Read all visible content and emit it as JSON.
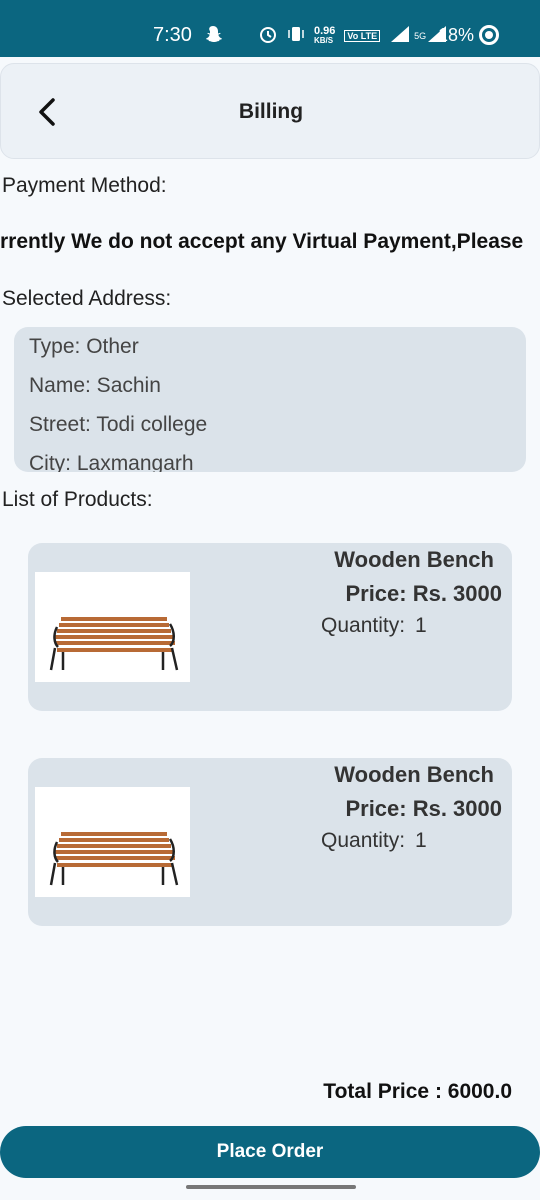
{
  "status_bar": {
    "time": "7:30",
    "speed_value": "0.96",
    "speed_unit": "KB/S",
    "network_volte": "Vo LTE",
    "network_5g": "5G",
    "battery_percent": "18%"
  },
  "header": {
    "title": "Billing"
  },
  "payment": {
    "label": "Payment Method:",
    "notice": "Currently We do not accept any Virtual Payment,Please"
  },
  "address": {
    "label": "Selected Address:",
    "type": "Type: Other",
    "name": "Name: Sachin",
    "street": "Street: Todi college",
    "city": "City: Laxmangarh"
  },
  "products": {
    "label": "List of Products:",
    "items": [
      {
        "name": "Wooden Bench",
        "price": "Price: Rs. 3000",
        "qty_label": "Quantity:",
        "qty_value": "1"
      },
      {
        "name": "Wooden Bench",
        "price": "Price: Rs. 3000",
        "qty_label": "Quantity:",
        "qty_value": "1"
      }
    ]
  },
  "footer": {
    "total": "Total Price : 6000.0",
    "place_order": "Place Order"
  },
  "colors": {
    "primary": "#0b6680",
    "card": "#dbe3ea",
    "background": "#f6f9fc"
  }
}
